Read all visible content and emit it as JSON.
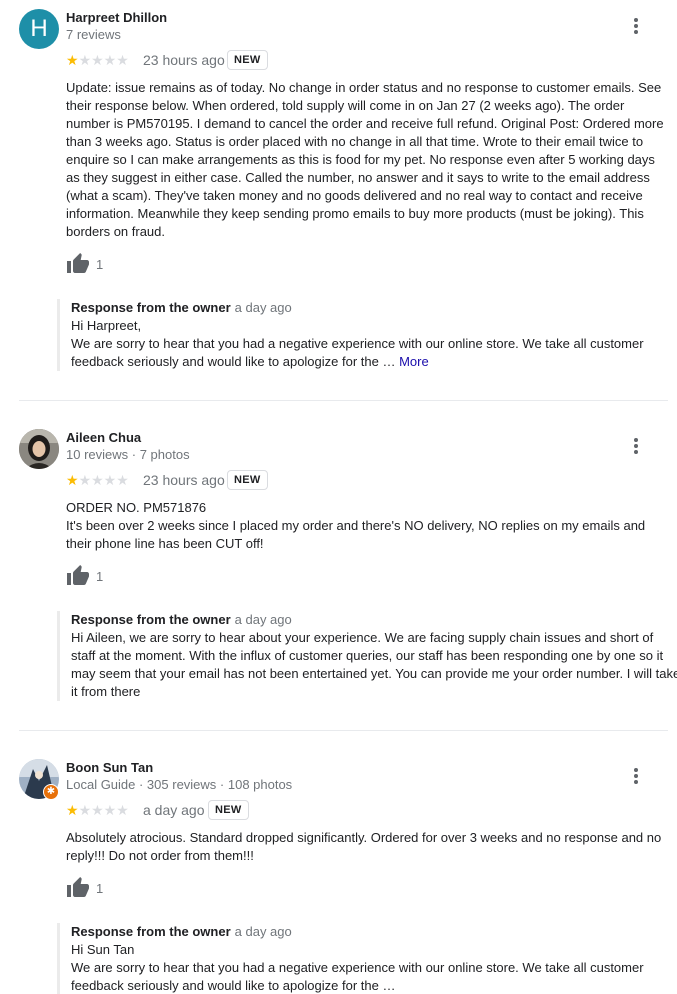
{
  "reviews": [
    {
      "avatar_letter": "H",
      "name": "Harpreet Dhillon",
      "meta": "7 reviews",
      "rating": 1,
      "time": "23 hours ago",
      "badge": "NEW",
      "text": "Update: issue remains as of today. No change in order status and no response to customer emails. See their response below. When ordered, told supply will come in on Jan 27 (2 weeks ago). The order number is PM570195. I demand to cancel the order and receive full refund.  Original Post: Ordered more than 3 weeks ago. Status is order placed with no change in all that time. Wrote to their email twice to enquire so I can make arrangements as this is food for my pet. No response even after 5 working days as they suggest in either case. Called the number, no answer and it says to write to the email address (what a scam). They've taken money and no goods delivered and no real way to contact and receive information. Meanwhile they keep sending promo emails to buy more products (must be joking). This borders on fraud.",
      "likes": "1",
      "response_title": "Response from the owner",
      "response_time": "a day ago",
      "response_line1": "Hi Harpreet,",
      "response_text": "We are sorry to hear that you had a negative experience with our online store. We take all customer feedback seriously and would like to apologize for the … ",
      "response_more": "More"
    },
    {
      "name": "Aileen Chua",
      "meta": "10 reviews · 7 photos",
      "rating": 1,
      "time": "23 hours ago",
      "badge": "NEW",
      "text_line1": "ORDER NO. PM571876",
      "text": "It's been over 2 weeks since I placed my order and there's NO delivery, NO replies on my emails and their phone line has been CUT off!",
      "likes": "1",
      "response_title": "Response from the owner",
      "response_time": "a day ago",
      "response_text": "Hi Aileen, we are sorry to hear about your experience. We are facing supply chain issues and short of staff at the moment. With the influx of customer queries, our staff has been responding one by one so it may seem that your email has not been entertained yet. You can provide me your order number. I will take it from there"
    },
    {
      "name": "Boon Sun Tan",
      "meta": "Local Guide · 305 reviews · 108 photos",
      "rating": 1,
      "time": "a day ago",
      "badge": "NEW",
      "text": "Absolutely atrocious. Standard dropped significantly. Ordered for over 3 weeks and no response and no reply!!! Do not order from them!!!",
      "likes": "1",
      "response_title": "Response from the owner",
      "response_time": "a day ago",
      "response_line1": "Hi Sun Tan",
      "response_text": "We are sorry to hear that you had a negative experience with our online store. We take all customer feedback seriously and would like to apologize for the …"
    }
  ],
  "icons": {
    "more": "more-vert-icon",
    "thumb": "thumb-up-icon",
    "star": "star-icon",
    "local_guide": "local-guide-badge-icon"
  },
  "colors": {
    "star_on": "#fbbc04",
    "star_off": "#dadce0",
    "avatar_h": "#1e8fa8",
    "link": "#1a0dab"
  }
}
